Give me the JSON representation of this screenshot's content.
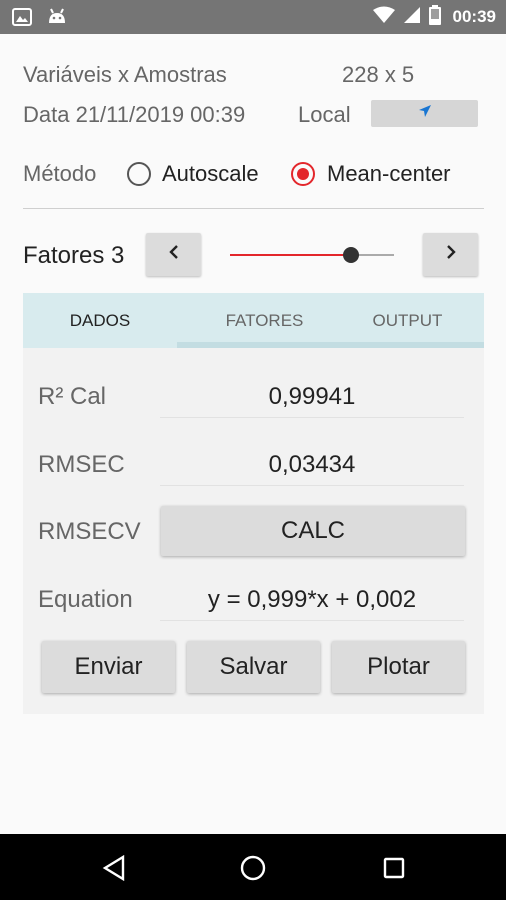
{
  "status_bar": {
    "time": "00:39",
    "left_icons": [
      "image-icon",
      "android-icon"
    ],
    "right_icons": [
      "wifi-icon",
      "signal-icon",
      "battery-icon"
    ]
  },
  "info": {
    "variables_label": "Variáveis x Amostras",
    "variables_value": "228 x 5",
    "date_label": "Data 21/11/2019 00:39",
    "local_label": "Local",
    "local_button_icon": "navigation-arrow-icon"
  },
  "method": {
    "label": "Método",
    "options": [
      {
        "label": "Autoscale",
        "selected": false
      },
      {
        "label": "Mean-center",
        "selected": true
      }
    ]
  },
  "factors": {
    "label": "Fatores 3",
    "prev_icon": "chevron-left-icon",
    "next_icon": "chevron-right-icon",
    "slider_fraction": 0.74
  },
  "tabs": [
    {
      "label": "DADOS",
      "active": true
    },
    {
      "label": "FATORES",
      "active": false
    },
    {
      "label": "OUTPUT",
      "active": false
    }
  ],
  "results": {
    "r2_label": "R² Cal",
    "r2_value": "0,99941",
    "rmsec_label": "RMSEC",
    "rmsec_value": "0,03434",
    "rmsecv_label": "RMSECV",
    "calc_label": "CALC",
    "equation_label": "Equation",
    "equation_value": "y = 0,999*x + 0,002"
  },
  "actions": {
    "send": "Enviar",
    "save": "Salvar",
    "plot": "Plotar"
  },
  "colors": {
    "accent": "#e3262b",
    "tab_bg": "#d8ebee",
    "status_bar": "#757575",
    "local_arrow": "#1976d2"
  }
}
